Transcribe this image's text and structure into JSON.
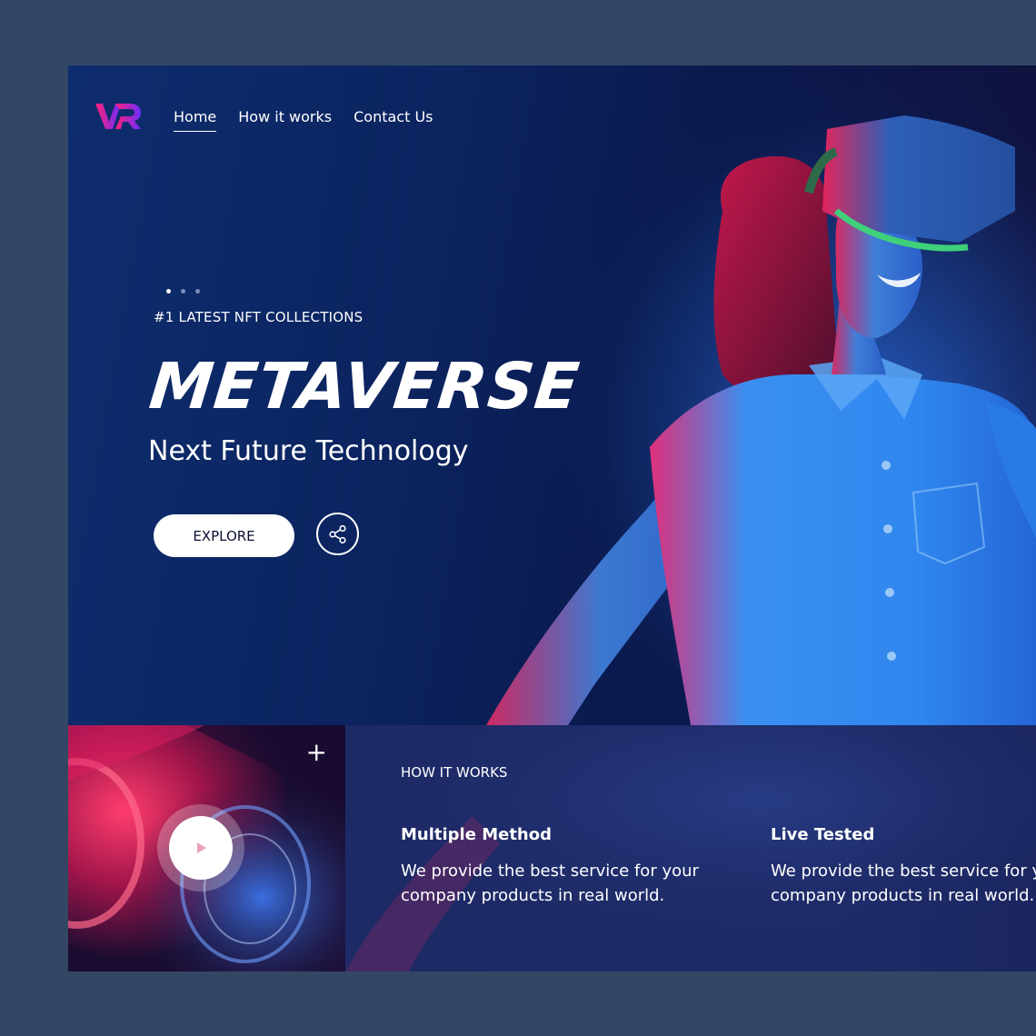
{
  "brand": {
    "logo_text": "VR",
    "colors": {
      "logo_start": "#ff1f7a",
      "logo_end": "#6b2cff"
    }
  },
  "nav": {
    "items": [
      {
        "label": "Home",
        "active": true
      },
      {
        "label": "How it works",
        "active": false
      },
      {
        "label": "Contact Us",
        "active": false
      }
    ]
  },
  "hero": {
    "slider": {
      "count": 3,
      "active_index": 0
    },
    "eyebrow": "#1 LATEST NFT COLLECTIONS",
    "headline": "METAVERSE",
    "subheadline": "Next Future Technology",
    "explore_label": "EXPLORE",
    "share_icon": "share-icon"
  },
  "media": {
    "plus_icon": "+",
    "play_icon": "play-icon"
  },
  "how_it_works": {
    "title": "HOW IT WORKS",
    "features": [
      {
        "title": "Multiple Method",
        "text": "We provide the best service for your company products in real world."
      },
      {
        "title": "Live Tested",
        "text": "We provide the best service for your company products in real world."
      }
    ]
  },
  "colors": {
    "page_bg": "#334765",
    "hero_bg": "#0c2460",
    "accent_pink": "#ff1f6e",
    "accent_blue": "#2a8cf0"
  }
}
